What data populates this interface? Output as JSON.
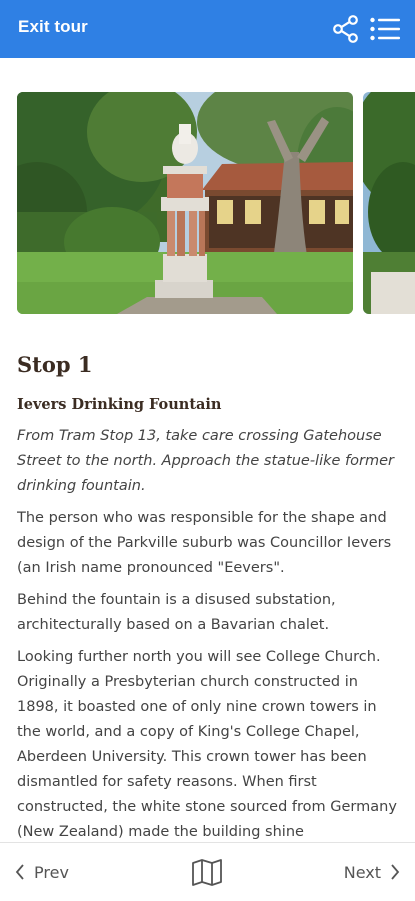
{
  "header": {
    "exit_label": "Exit tour",
    "share_icon": "share-icon",
    "list_icon": "list-icon",
    "background": "#2f80e4"
  },
  "stop": {
    "title": "Stop 1",
    "subtitle": "Ievers Drinking Fountain",
    "intro": "From Tram Stop 13, take care crossing Gatehouse Street to the north. Approach the statue-like former drinking fountain.",
    "paragraphs": [
      "The person who was responsible for the shape and design of the Parkville suburb was Councillor Ievers (an Irish name pronounced \"Eevers\".",
      "Behind the fountain is a disused substation, architecturally based on a Bavarian chalet.",
      "Looking further north you will see College Church. Originally a Presbyterian church constructed in 1898, it boasted one of only nine crown towers in the world, and a copy of King's College Chapel, Aberdeen University. This crown tower has been dismantled for safety reasons. When first constructed, the white stone sourced from Germany (New Zealand) made the building shine"
    ]
  },
  "footer": {
    "prev_label": "Prev",
    "next_label": "Next",
    "map_icon": "map-icon"
  }
}
